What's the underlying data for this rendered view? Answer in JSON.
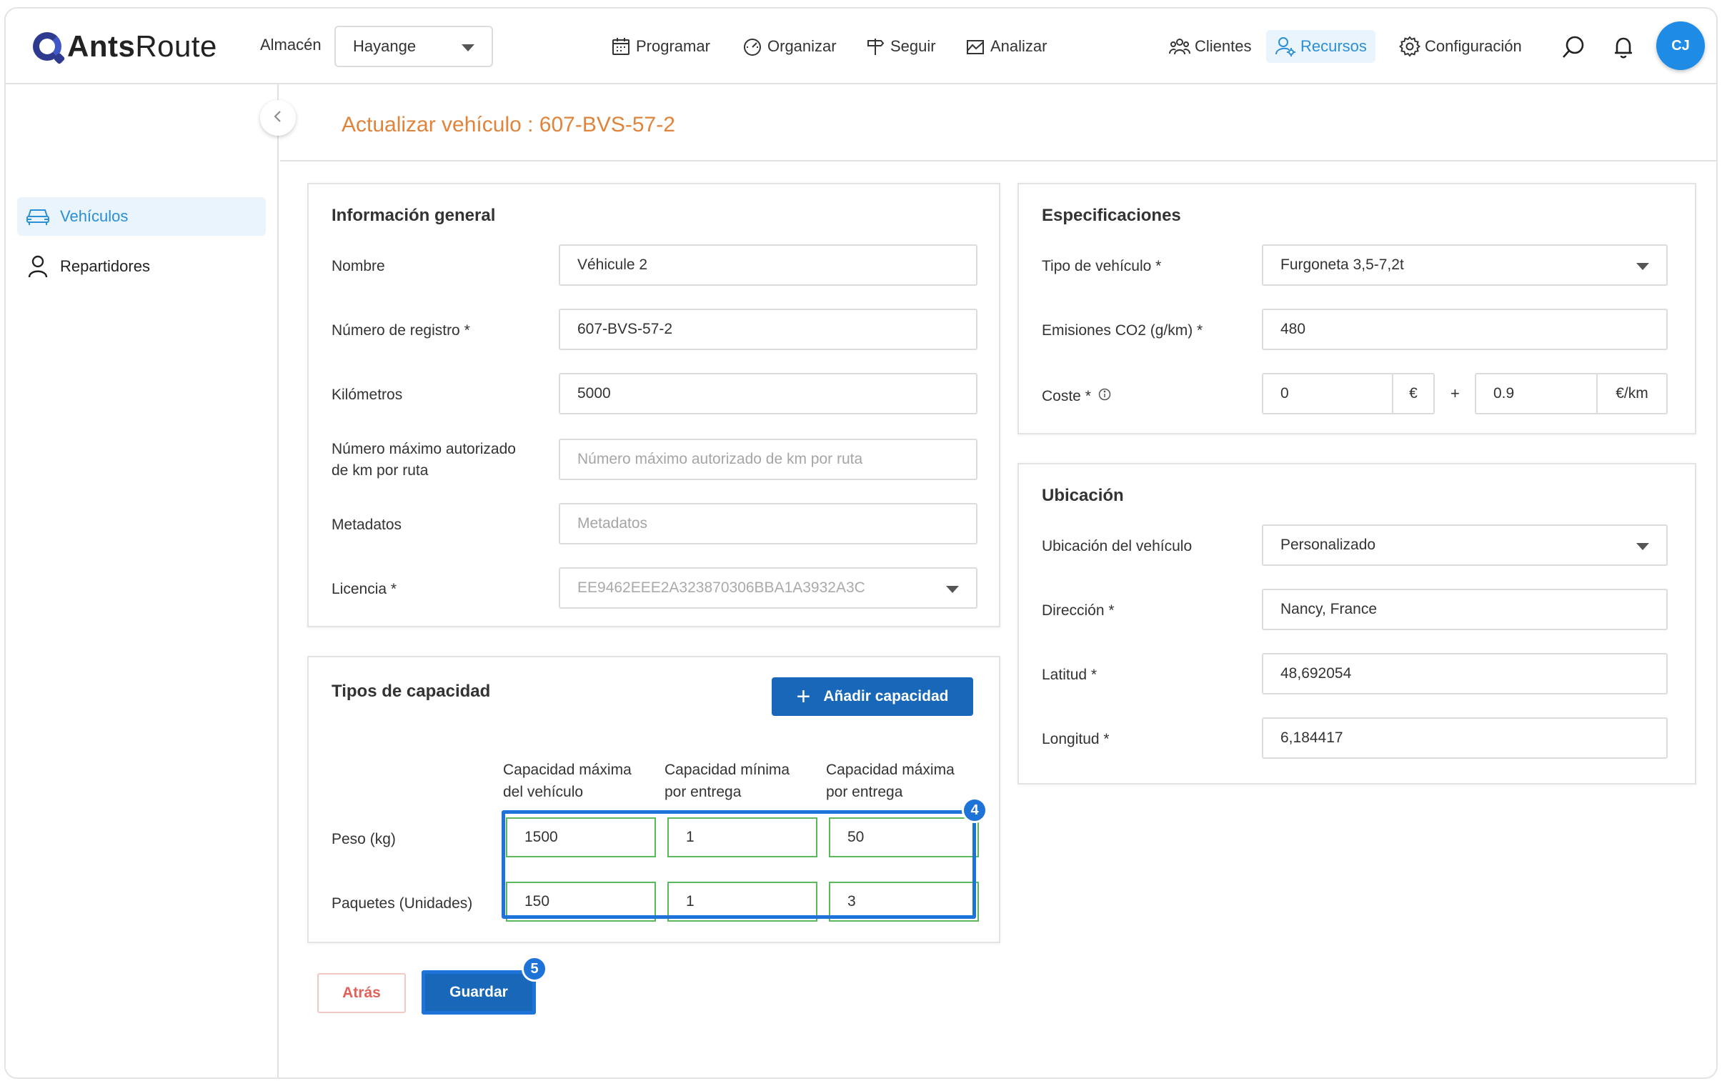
{
  "app": {
    "logo_bold": "Ants",
    "logo_light": "Route"
  },
  "topbar": {
    "warehouse_label": "Almacén",
    "warehouse_value": "Hayange",
    "nav": {
      "programar": "Programar",
      "organizar": "Organizar",
      "seguir": "Seguir",
      "analizar": "Analizar",
      "clientes": "Clientes",
      "recursos": "Recursos",
      "configuracion": "Configuración"
    },
    "avatar_initials": "CJ"
  },
  "sidebar": {
    "items": [
      {
        "label": "Vehículos",
        "icon": "car-icon",
        "active": true
      },
      {
        "label": "Repartidores",
        "icon": "person-icon",
        "active": false
      }
    ]
  },
  "page": {
    "title": "Actualizar vehículo : 607-BVS-57-2"
  },
  "general": {
    "title": "Información general",
    "nombre_label": "Nombre",
    "nombre_value": "Véhicule 2",
    "registro_label": "Número de registro *",
    "registro_value": "607-BVS-57-2",
    "km_label": "Kilómetros",
    "km_value": "5000",
    "maxkm_label_1": "Número máximo autorizado",
    "maxkm_label_2": "de km por ruta",
    "maxkm_placeholder": "Número máximo autorizado de km por ruta",
    "meta_label": "Metadatos",
    "meta_placeholder": "Metadatos",
    "licencia_label": "Licencia *",
    "licencia_value": "EE9462EEE2A323870306BBA1A3932A3C"
  },
  "capacity": {
    "title": "Tipos de capacidad",
    "add_button": "Añadir capacidad",
    "columns": [
      [
        "Capacidad máxima",
        "del vehículo"
      ],
      [
        "Capacidad mínima",
        "por entrega"
      ],
      [
        "Capacidad máxima",
        "por entrega"
      ]
    ],
    "rows": [
      {
        "label": "Peso (kg)",
        "values": [
          "1500",
          "1",
          "50"
        ]
      },
      {
        "label": "Paquetes (Unidades)",
        "values": [
          "150",
          "1",
          "3"
        ]
      }
    ],
    "step_badge": "4"
  },
  "specs": {
    "title": "Especificaciones",
    "tipo_label": "Tipo de vehículo *",
    "tipo_value": "Furgoneta 3,5-7,2t",
    "co2_label": "Emisiones CO2 (g/km) *",
    "co2_value": "480",
    "coste_label": "Coste *",
    "coste_fixed": "0",
    "coste_fixed_unit": "€",
    "coste_plus": "+",
    "coste_var": "0.9",
    "coste_var_unit": "€/km"
  },
  "location": {
    "title": "Ubicación",
    "ubic_label": "Ubicación del vehículo",
    "ubic_value": "Personalizado",
    "dir_label": "Dirección *",
    "dir_value": "Nancy, France",
    "lat_label": "Latitud *",
    "lat_value": "48,692054",
    "lon_label": "Longitud *",
    "lon_value": "6,184417"
  },
  "actions": {
    "back": "Atrás",
    "save": "Guardar",
    "save_badge": "5"
  },
  "colors": {
    "accent": "#2b8fd6",
    "primary_button": "#1967b8",
    "title": "#e0833b",
    "highlight": "#1e73d8",
    "valid_border": "#5cb85c"
  }
}
